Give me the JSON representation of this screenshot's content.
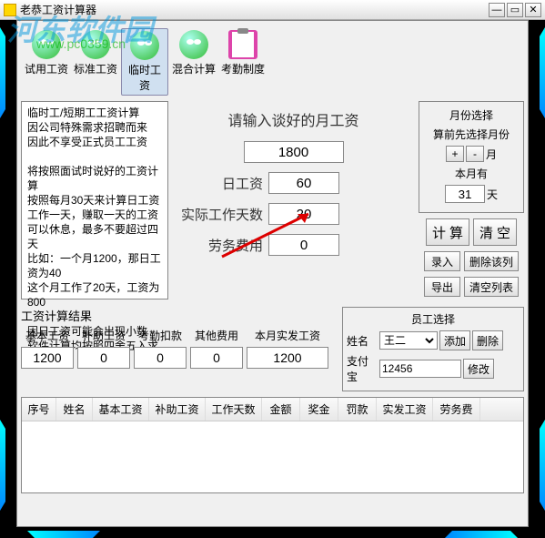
{
  "window": {
    "title": "老恭工资计算器"
  },
  "watermark": {
    "text": "河东软件园",
    "url": "www.pc0359.cn"
  },
  "toolbar": {
    "items": [
      {
        "label": "试用工资"
      },
      {
        "label": "标准工资"
      },
      {
        "label": "临时工资"
      },
      {
        "label": "混合计算"
      },
      {
        "label": "考勤制度"
      }
    ]
  },
  "description": "临时工/短期工工资计算\n因公司特殊需求招聘而来\n因此不享受正式员工工资\n\n将按照面试时说好的工资计算\n按照每月30天来计算日工资\n工作一天，赚取一天的工资\n可以休息，最多不要超过四天\n比如：一个月1200，那日工资为40\n这个月工作了20天，工资为800\n\n因日工资可能会出现小数\n软件计算均按照四舍五入求得最终值",
  "center": {
    "prompt": "请输入谈好的月工资",
    "monthly_wage": "1800",
    "daily_wage_label": "日工资",
    "daily_wage": "60",
    "work_days_label": "实际工作天数",
    "work_days": "20",
    "labor_fee_label": "劳务费用",
    "labor_fee": "0"
  },
  "month": {
    "title": "月份选择",
    "subtitle": "算前先选择月份",
    "plus": "+",
    "minus": "-",
    "month_suffix": "月",
    "current_label": "本月有",
    "days": "31",
    "days_suffix": "天"
  },
  "actions": {
    "calc": "计算",
    "clear": "清空",
    "record": "录入",
    "delete_row": "删除该列",
    "export": "导出",
    "clear_list": "清空列表"
  },
  "result": {
    "title": "工资计算结果",
    "headers": {
      "base": "基本工资",
      "subsidy": "补助工资",
      "attendance": "考勤扣款",
      "other": "其他费用",
      "actual": "本月实发工资"
    },
    "values": {
      "base": "1200",
      "subsidy": "0",
      "attendance": "0",
      "other": "0",
      "actual": "1200"
    }
  },
  "employee": {
    "title": "员工选择",
    "name_label": "姓名",
    "name_value": "王二",
    "add": "添加",
    "delete": "删除",
    "alipay_label": "支付宝",
    "alipay_value": "12456",
    "modify": "修改"
  },
  "table": {
    "columns": [
      "序号",
      "姓名",
      "基本工资",
      "补助工资",
      "工作天数",
      "金额",
      "奖金",
      "罚款",
      "实发工资",
      "劳务费"
    ]
  }
}
